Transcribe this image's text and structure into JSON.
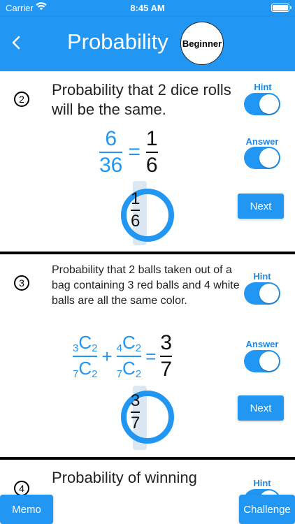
{
  "status_bar": {
    "carrier": "Carrier",
    "time": "8:45 AM"
  },
  "header": {
    "title": "Probability",
    "level": "Beginner"
  },
  "problems": [
    {
      "number": "2",
      "question": "Probability that 2 dice rolls will be the same.",
      "hint_label": "Hint",
      "answer_label": "Answer",
      "hint_on": true,
      "answer_on": true,
      "formula": {
        "lhs_num": "6",
        "lhs_den": "36",
        "equals": "=",
        "rhs_num": "1",
        "rhs_den": "6"
      },
      "scratch": {
        "num": "1",
        "den": "6"
      },
      "next_label": "Next"
    },
    {
      "number": "3",
      "question": "Probability that 2 balls taken out of a bag containing 3 red balls and 4 white balls are all the same color.",
      "hint_label": "Hint",
      "answer_label": "Answer",
      "hint_on": true,
      "answer_on": true,
      "formula": {
        "t1_num_pre": "3",
        "t1_num_main": "C",
        "t1_num_post": "2",
        "t1_den_pre": "7",
        "t1_den_main": "C",
        "t1_den_post": "2",
        "plus": "+",
        "t2_num_pre": "4",
        "t2_num_main": "C",
        "t2_num_post": "2",
        "t2_den_pre": "7",
        "t2_den_main": "C",
        "t2_den_post": "2",
        "equals": "=",
        "rhs_num": "3",
        "rhs_den": "7"
      },
      "scratch": {
        "num": "3",
        "den": "7"
      },
      "next_label": "Next"
    },
    {
      "number": "4",
      "question": "Probability of winning",
      "hint_label": "Hint"
    }
  ],
  "footer": {
    "memo_label": "Memo",
    "challenge_label": "Challenge"
  },
  "colors": {
    "primary": "#2196f3",
    "label": "#1e88e5"
  },
  "icons": {
    "back": "chevron-left-icon",
    "wifi": "wifi-icon",
    "battery": "battery-icon"
  }
}
